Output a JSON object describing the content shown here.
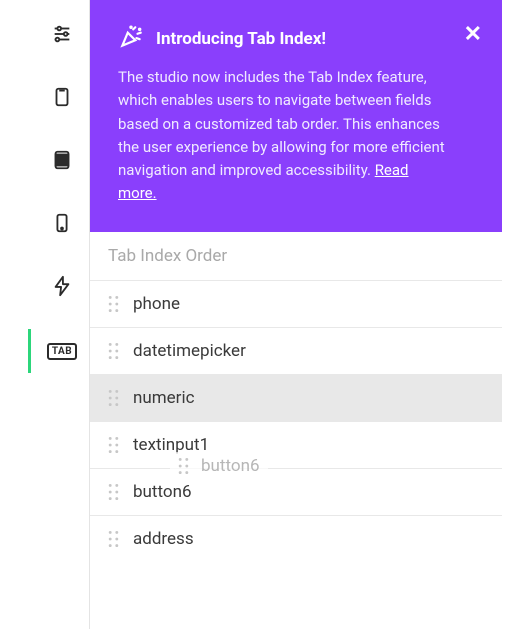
{
  "sidebar": {
    "items": [
      {
        "name": "settings"
      },
      {
        "name": "device-portrait"
      },
      {
        "name": "device-tablet"
      },
      {
        "name": "device-mobile"
      },
      {
        "name": "lightning"
      },
      {
        "name": "tab-index",
        "label": "TAB"
      }
    ]
  },
  "banner": {
    "title": "Introducing Tab Index!",
    "body_prefix": "The studio now includes the Tab Index feature, which enables users to navigate between fields based on a customized tab order. This enhances the user experience by allowing for more efficient navigation and improved accessibility.  ",
    "link_text": "Read more."
  },
  "section_header": "Tab Index Order",
  "rows": [
    {
      "label": "phone"
    },
    {
      "label": "datetimepicker"
    },
    {
      "label": "numeric"
    },
    {
      "label": "textinput1"
    },
    {
      "label": "button6"
    },
    {
      "label": "address"
    }
  ],
  "floating": {
    "label": "button6"
  }
}
